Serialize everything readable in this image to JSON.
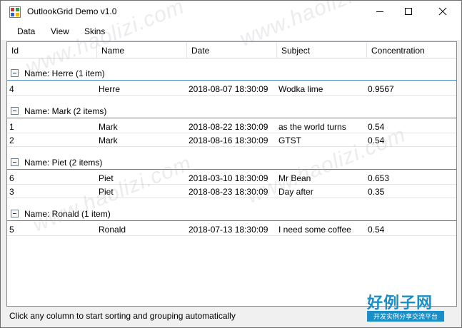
{
  "window": {
    "title": "OutlookGrid Demo v1.0"
  },
  "menu": {
    "items": [
      {
        "label": "Data"
      },
      {
        "label": "View"
      },
      {
        "label": "Skins"
      }
    ]
  },
  "grid": {
    "columns": [
      "Id",
      "Name",
      "Date",
      "Subject",
      "Concentration"
    ],
    "groups": [
      {
        "label": "Name: Herre (1 item)",
        "rows": [
          {
            "id": "4",
            "name": "Herre",
            "date": "2018-08-07 18:30:09",
            "subject": "Wodka lime",
            "concentration": "0.9567"
          }
        ]
      },
      {
        "label": "Name: Mark (2 items)",
        "rows": [
          {
            "id": "1",
            "name": "Mark",
            "date": "2018-08-22 18:30:09",
            "subject": "as the world turns",
            "concentration": "0.54"
          },
          {
            "id": "2",
            "name": "Mark",
            "date": "2018-08-16 18:30:09",
            "subject": "GTST",
            "concentration": "0.54"
          }
        ]
      },
      {
        "label": "Name: Piet (2 items)",
        "rows": [
          {
            "id": "6",
            "name": "Piet",
            "date": "2018-03-10 18:30:09",
            "subject": "Mr Bean",
            "concentration": "0.653"
          },
          {
            "id": "3",
            "name": "Piet",
            "date": "2018-08-23 18:30:09",
            "subject": "Day after",
            "concentration": "0.35"
          }
        ]
      },
      {
        "label": "Name: Ronald (1 item)",
        "rows": [
          {
            "id": "5",
            "name": "Ronald",
            "date": "2018-07-13 18:30:09",
            "subject": "I need some coffee",
            "concentration": "0.54"
          }
        ]
      }
    ]
  },
  "status": {
    "text": "Click any column to start sorting and grouping automatically"
  },
  "watermark": {
    "text": "www.haolizi.com"
  },
  "brand": {
    "main": "好例子网",
    "sub": "开发实例分享交流平台"
  },
  "colors": {
    "group_line": "#4f84c4",
    "brand": "#1a8ec7"
  }
}
